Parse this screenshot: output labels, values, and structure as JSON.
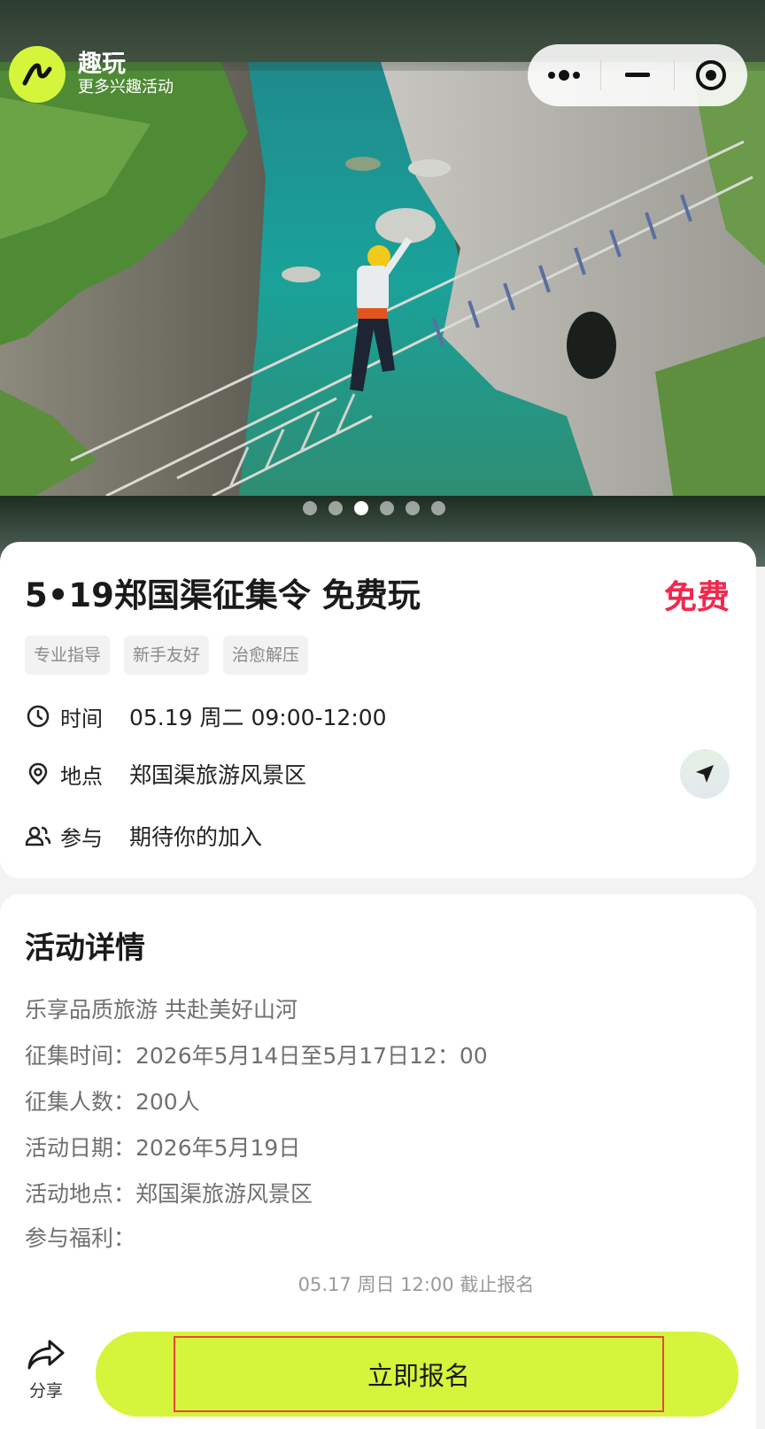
{
  "brand": {
    "name": "趣玩",
    "subtitle": "更多兴趣活动"
  },
  "carousel": {
    "count": 6,
    "active_index": 2
  },
  "event": {
    "title": "5•19郑国渠征集令 免费玩",
    "price": "免费",
    "tags": [
      "专业指导",
      "新手友好",
      "治愈解压"
    ],
    "time": {
      "label": "时间",
      "value": "05.19 周二 09:00-12:00"
    },
    "location": {
      "label": "地点",
      "value": "郑国渠旅游风景区"
    },
    "participants": {
      "label": "参与",
      "value": "期待你的加入"
    }
  },
  "details": {
    "heading": "活动详情",
    "lines": [
      "乐享品质旅游 共赴美好山河",
      "征集时间：2026年5月14日至5月17日12：00",
      "征集人数：200人",
      "活动日期：2026年5月19日",
      "活动地点：郑国渠旅游风景区",
      "参与福利："
    ],
    "deadline": "05.17 周日 12:00 截止报名"
  },
  "actions": {
    "share_label": "分享",
    "signup_label": "立即报名"
  },
  "colors": {
    "accent": "#d4f53b",
    "price": "#f0294f",
    "highlight_border": "#e8463c"
  }
}
